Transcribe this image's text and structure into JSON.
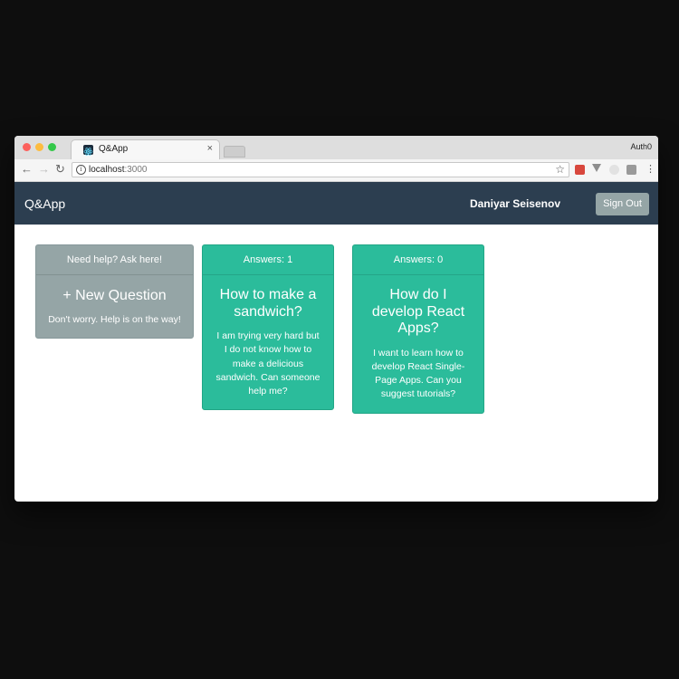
{
  "browser": {
    "tab_title": "Q&App",
    "profile_name": "Auth0",
    "url_host": "localhost",
    "url_port": ":3000",
    "traffic_colors": [
      "#fc605c",
      "#fdbc40",
      "#34c84a"
    ]
  },
  "app": {
    "brand": "Q&App",
    "user_name": "Daniyar Seisenov",
    "sign_out_label": "Sign Out",
    "colors": {
      "navbar": "#2c3e50",
      "card_green": "#2bbc9b",
      "card_grey": "#95a5a6"
    }
  },
  "new_question_card": {
    "header": "Need help? Ask here!",
    "title": "+ New Question",
    "text": "Don't worry. Help is on the way!"
  },
  "questions": [
    {
      "header": "Answers: 1",
      "title": "How to make a sandwich?",
      "text": "I am trying very hard but I do not know how to make a delicious sandwich. Can someone help me?"
    },
    {
      "header": "Answers: 0",
      "title": "How do I develop React Apps?",
      "text": "I want to learn how to develop React Single-Page Apps. Can you suggest tutorials?"
    }
  ]
}
